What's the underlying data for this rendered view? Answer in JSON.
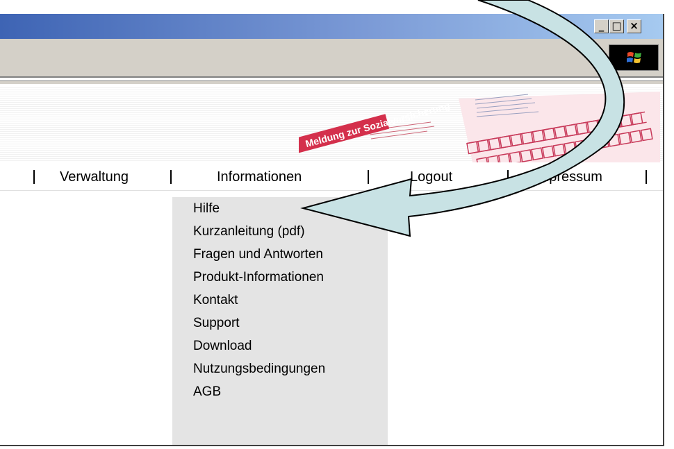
{
  "window": {
    "controls": {
      "minimize": "_",
      "maximize": "□",
      "close": "×"
    },
    "throbber_icon": "windows-logo-icon"
  },
  "banner": {
    "form_stamp_text": "Meldung zur Sozialversicherung"
  },
  "nav": {
    "items": [
      {
        "label": "Verwaltung"
      },
      {
        "label": "Informationen"
      },
      {
        "label": "Logout"
      },
      {
        "label": "Impressum"
      }
    ]
  },
  "menu": {
    "items": [
      {
        "label": "Hilfe"
      },
      {
        "label": "Kurzanleitung (pdf)"
      },
      {
        "label": "Fragen und Antworten"
      },
      {
        "label": "Produkt-Informationen"
      },
      {
        "label": "Kontakt"
      },
      {
        "label": "Support"
      },
      {
        "label": "Download"
      },
      {
        "label": "Nutzungsbedingungen"
      },
      {
        "label": "AGB"
      }
    ]
  },
  "colors": {
    "titlebar_start": "#3e64b4",
    "titlebar_end": "#a6caf0",
    "dropdown_bg": "#e4e4e4",
    "arrow_fill": "#c8e2e4",
    "stamp_red": "#d4304c"
  }
}
